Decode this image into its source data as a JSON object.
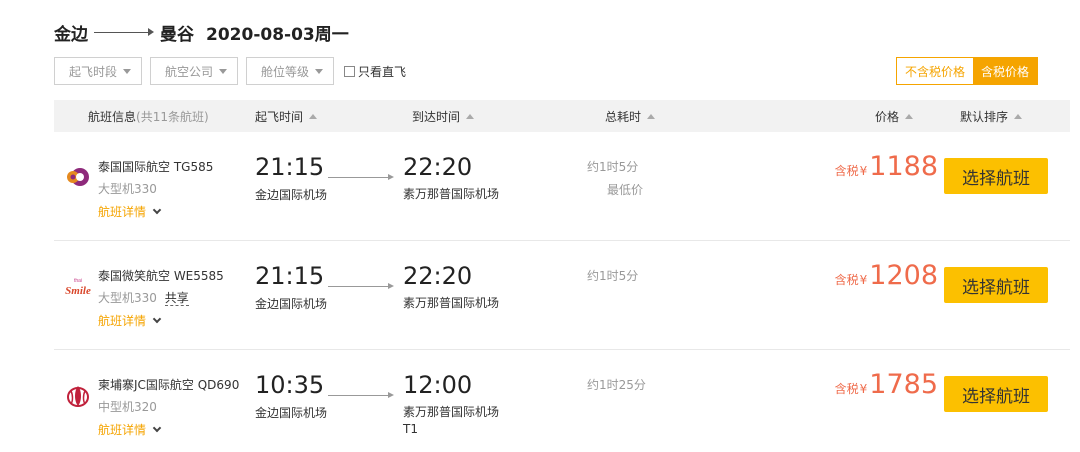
{
  "route": {
    "from": "金边",
    "to": "曼谷",
    "date": "2020-08-03周一"
  },
  "filters": {
    "depart_period": "起飞时段",
    "airline": "航空公司",
    "cabin": "舱位等级",
    "direct_only": "只看直飞"
  },
  "price_toggle": {
    "excl_tax": "不含税价格",
    "incl_tax": "含税价格"
  },
  "header": {
    "flight_info": "航班信息",
    "flight_count": "(共11条航班)",
    "depart_time": "起飞时间",
    "arrive_time": "到达时间",
    "duration": "总耗时",
    "price": "价格",
    "sort": "默认排序"
  },
  "flights": [
    {
      "airline": "泰国国际航空 TG585",
      "aircraft": "大型机330",
      "share": "",
      "details": "航班详情",
      "dep_time": "21:15",
      "dep_airport": "金边国际机场",
      "arr_time": "22:20",
      "arr_airport": "素万那普国际机场",
      "duration": "约1时5分",
      "note": "最低价",
      "tax_label": "含税",
      "currency": "¥",
      "price": "1188",
      "button": "选择航班"
    },
    {
      "airline": "泰国微笑航空 WE5585",
      "aircraft": "大型机330",
      "share": "共享",
      "details": "航班详情",
      "dep_time": "21:15",
      "dep_airport": "金边国际机场",
      "arr_time": "22:20",
      "arr_airport": "素万那普国际机场",
      "duration": "约1时5分",
      "note": "",
      "tax_label": "含税",
      "currency": "¥",
      "price": "1208",
      "button": "选择航班"
    },
    {
      "airline": "柬埔寨JC国际航空 QD690",
      "aircraft": "中型机320",
      "share": "",
      "details": "航班详情",
      "dep_time": "10:35",
      "dep_airport": "金边国际机场",
      "arr_time": "12:00",
      "arr_airport": "素万那普国际机场T1",
      "duration": "约1时25分",
      "note": "",
      "tax_label": "含税",
      "currency": "¥",
      "price": "1785",
      "button": "选择航班"
    }
  ],
  "colors": {
    "accent": "#f5a400",
    "button": "#fcc000",
    "price": "#ef6b4b"
  },
  "icons": {
    "sort": "triangle-up-icon",
    "dropdown": "caret-down-icon",
    "expand": "chevron-down-icon"
  }
}
